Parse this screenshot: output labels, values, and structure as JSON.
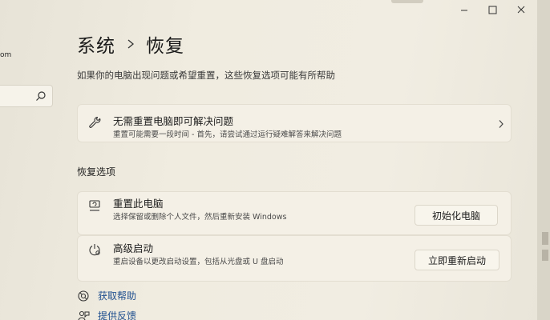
{
  "nav": {
    "email_fragment": "om",
    "search_placeholder": ""
  },
  "titlebar": {
    "minimize": "–",
    "maximize": "☐",
    "close": "✕"
  },
  "breadcrumb": {
    "parent": "系统",
    "current": "恢复"
  },
  "page_description": "如果你的电脑出现问题或希望重置，这些恢复选项可能有所帮助",
  "troubleshoot_card": {
    "title": "无需重置电脑即可解决问题",
    "subtitle": "重置可能需要一段时间 - 首先，请尝试通过运行疑难解答来解决问题",
    "icon": "wrench-icon"
  },
  "recovery_section_title": "恢复选项",
  "reset_card": {
    "title": "重置此电脑",
    "subtitle": "选择保留或删除个人文件，然后重新安装 Windows",
    "button": "初始化电脑",
    "icon": "reset-pc-icon"
  },
  "advanced_card": {
    "title": "高级启动",
    "subtitle": "重启设备以更改启动设置，包括从光盘或 U 盘启动",
    "button": "立即重新启动",
    "icon": "advanced-startup-icon"
  },
  "links": [
    {
      "label": "获取帮助",
      "icon": "help-icon"
    },
    {
      "label": "提供反馈",
      "icon": "feedback-icon"
    }
  ],
  "colors": {
    "background": "#f1ede2",
    "card": "#f4f0e6",
    "link": "#1f4f8f"
  }
}
